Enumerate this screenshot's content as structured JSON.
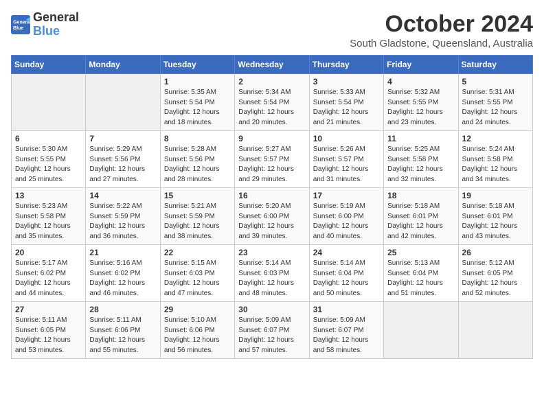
{
  "header": {
    "logo_line1": "General",
    "logo_line2": "Blue",
    "month": "October 2024",
    "location": "South Gladstone, Queensland, Australia"
  },
  "weekdays": [
    "Sunday",
    "Monday",
    "Tuesday",
    "Wednesday",
    "Thursday",
    "Friday",
    "Saturday"
  ],
  "weeks": [
    [
      {
        "day": "",
        "sunrise": "",
        "sunset": "",
        "daylight": ""
      },
      {
        "day": "",
        "sunrise": "",
        "sunset": "",
        "daylight": ""
      },
      {
        "day": "1",
        "sunrise": "Sunrise: 5:35 AM",
        "sunset": "Sunset: 5:54 PM",
        "daylight": "Daylight: 12 hours and 18 minutes."
      },
      {
        "day": "2",
        "sunrise": "Sunrise: 5:34 AM",
        "sunset": "Sunset: 5:54 PM",
        "daylight": "Daylight: 12 hours and 20 minutes."
      },
      {
        "day": "3",
        "sunrise": "Sunrise: 5:33 AM",
        "sunset": "Sunset: 5:54 PM",
        "daylight": "Daylight: 12 hours and 21 minutes."
      },
      {
        "day": "4",
        "sunrise": "Sunrise: 5:32 AM",
        "sunset": "Sunset: 5:55 PM",
        "daylight": "Daylight: 12 hours and 23 minutes."
      },
      {
        "day": "5",
        "sunrise": "Sunrise: 5:31 AM",
        "sunset": "Sunset: 5:55 PM",
        "daylight": "Daylight: 12 hours and 24 minutes."
      }
    ],
    [
      {
        "day": "6",
        "sunrise": "Sunrise: 5:30 AM",
        "sunset": "Sunset: 5:55 PM",
        "daylight": "Daylight: 12 hours and 25 minutes."
      },
      {
        "day": "7",
        "sunrise": "Sunrise: 5:29 AM",
        "sunset": "Sunset: 5:56 PM",
        "daylight": "Daylight: 12 hours and 27 minutes."
      },
      {
        "day": "8",
        "sunrise": "Sunrise: 5:28 AM",
        "sunset": "Sunset: 5:56 PM",
        "daylight": "Daylight: 12 hours and 28 minutes."
      },
      {
        "day": "9",
        "sunrise": "Sunrise: 5:27 AM",
        "sunset": "Sunset: 5:57 PM",
        "daylight": "Daylight: 12 hours and 29 minutes."
      },
      {
        "day": "10",
        "sunrise": "Sunrise: 5:26 AM",
        "sunset": "Sunset: 5:57 PM",
        "daylight": "Daylight: 12 hours and 31 minutes."
      },
      {
        "day": "11",
        "sunrise": "Sunrise: 5:25 AM",
        "sunset": "Sunset: 5:58 PM",
        "daylight": "Daylight: 12 hours and 32 minutes."
      },
      {
        "day": "12",
        "sunrise": "Sunrise: 5:24 AM",
        "sunset": "Sunset: 5:58 PM",
        "daylight": "Daylight: 12 hours and 34 minutes."
      }
    ],
    [
      {
        "day": "13",
        "sunrise": "Sunrise: 5:23 AM",
        "sunset": "Sunset: 5:58 PM",
        "daylight": "Daylight: 12 hours and 35 minutes."
      },
      {
        "day": "14",
        "sunrise": "Sunrise: 5:22 AM",
        "sunset": "Sunset: 5:59 PM",
        "daylight": "Daylight: 12 hours and 36 minutes."
      },
      {
        "day": "15",
        "sunrise": "Sunrise: 5:21 AM",
        "sunset": "Sunset: 5:59 PM",
        "daylight": "Daylight: 12 hours and 38 minutes."
      },
      {
        "day": "16",
        "sunrise": "Sunrise: 5:20 AM",
        "sunset": "Sunset: 6:00 PM",
        "daylight": "Daylight: 12 hours and 39 minutes."
      },
      {
        "day": "17",
        "sunrise": "Sunrise: 5:19 AM",
        "sunset": "Sunset: 6:00 PM",
        "daylight": "Daylight: 12 hours and 40 minutes."
      },
      {
        "day": "18",
        "sunrise": "Sunrise: 5:18 AM",
        "sunset": "Sunset: 6:01 PM",
        "daylight": "Daylight: 12 hours and 42 minutes."
      },
      {
        "day": "19",
        "sunrise": "Sunrise: 5:18 AM",
        "sunset": "Sunset: 6:01 PM",
        "daylight": "Daylight: 12 hours and 43 minutes."
      }
    ],
    [
      {
        "day": "20",
        "sunrise": "Sunrise: 5:17 AM",
        "sunset": "Sunset: 6:02 PM",
        "daylight": "Daylight: 12 hours and 44 minutes."
      },
      {
        "day": "21",
        "sunrise": "Sunrise: 5:16 AM",
        "sunset": "Sunset: 6:02 PM",
        "daylight": "Daylight: 12 hours and 46 minutes."
      },
      {
        "day": "22",
        "sunrise": "Sunrise: 5:15 AM",
        "sunset": "Sunset: 6:03 PM",
        "daylight": "Daylight: 12 hours and 47 minutes."
      },
      {
        "day": "23",
        "sunrise": "Sunrise: 5:14 AM",
        "sunset": "Sunset: 6:03 PM",
        "daylight": "Daylight: 12 hours and 48 minutes."
      },
      {
        "day": "24",
        "sunrise": "Sunrise: 5:14 AM",
        "sunset": "Sunset: 6:04 PM",
        "daylight": "Daylight: 12 hours and 50 minutes."
      },
      {
        "day": "25",
        "sunrise": "Sunrise: 5:13 AM",
        "sunset": "Sunset: 6:04 PM",
        "daylight": "Daylight: 12 hours and 51 minutes."
      },
      {
        "day": "26",
        "sunrise": "Sunrise: 5:12 AM",
        "sunset": "Sunset: 6:05 PM",
        "daylight": "Daylight: 12 hours and 52 minutes."
      }
    ],
    [
      {
        "day": "27",
        "sunrise": "Sunrise: 5:11 AM",
        "sunset": "Sunset: 6:05 PM",
        "daylight": "Daylight: 12 hours and 53 minutes."
      },
      {
        "day": "28",
        "sunrise": "Sunrise: 5:11 AM",
        "sunset": "Sunset: 6:06 PM",
        "daylight": "Daylight: 12 hours and 55 minutes."
      },
      {
        "day": "29",
        "sunrise": "Sunrise: 5:10 AM",
        "sunset": "Sunset: 6:06 PM",
        "daylight": "Daylight: 12 hours and 56 minutes."
      },
      {
        "day": "30",
        "sunrise": "Sunrise: 5:09 AM",
        "sunset": "Sunset: 6:07 PM",
        "daylight": "Daylight: 12 hours and 57 minutes."
      },
      {
        "day": "31",
        "sunrise": "Sunrise: 5:09 AM",
        "sunset": "Sunset: 6:07 PM",
        "daylight": "Daylight: 12 hours and 58 minutes."
      },
      {
        "day": "",
        "sunrise": "",
        "sunset": "",
        "daylight": ""
      },
      {
        "day": "",
        "sunrise": "",
        "sunset": "",
        "daylight": ""
      }
    ]
  ]
}
